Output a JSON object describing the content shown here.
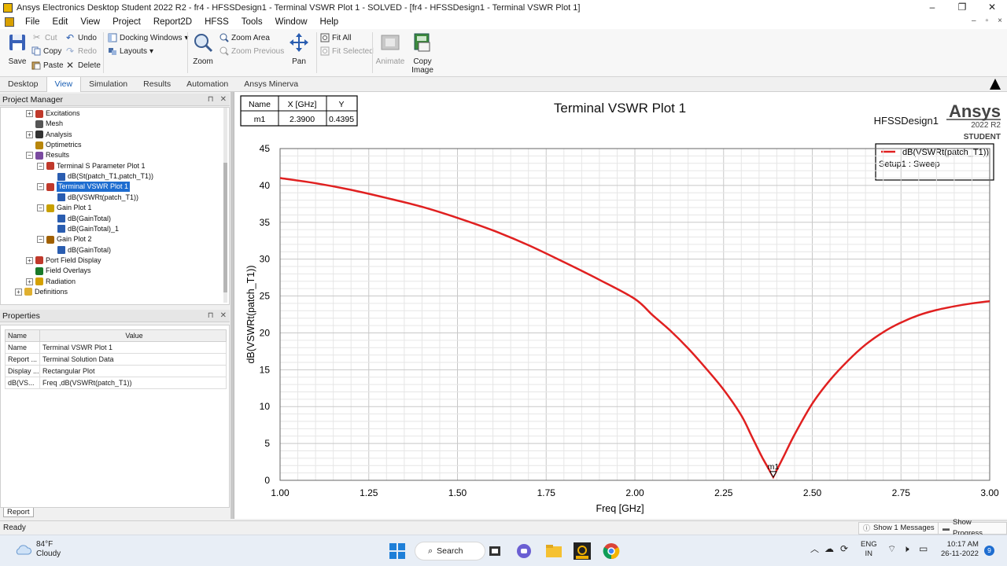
{
  "window": {
    "title": "Ansys Electronics Desktop Student 2022 R2 - fr4 - HFSSDesign1 - Terminal VSWR Plot 1 - SOLVED - [fr4 - HFSSDesign1 - Terminal VSWR Plot 1]",
    "buttons": {
      "minimize": "–",
      "restore": "❐",
      "close": "✕"
    }
  },
  "menu": [
    "File",
    "Edit",
    "View",
    "Project",
    "Report2D",
    "HFSS",
    "Tools",
    "Window",
    "Help"
  ],
  "mdi_buttons": {
    "minimize": "–",
    "restore": "▫",
    "close": "×"
  },
  "ribbon": {
    "save": "Save",
    "cut": "Cut",
    "copy": "Copy",
    "paste": "Paste",
    "undo": "Undo",
    "redo": "Redo",
    "delete": "Delete",
    "docking_windows": "Docking Windows",
    "layouts": "Layouts",
    "zoom": "Zoom",
    "zoom_area": "Zoom Area",
    "zoom_previous": "Zoom Previous",
    "pan": "Pan",
    "fit_all": "Fit All",
    "fit_selected": "Fit Selected",
    "animate": "Animate",
    "copy_image_1": "Copy",
    "copy_image_2": "Image"
  },
  "tabs": [
    "Desktop",
    "View",
    "Simulation",
    "Results",
    "Automation",
    "Ansys Minerva"
  ],
  "active_tab": "View",
  "project_manager": {
    "title": "Project Manager",
    "pin": "⊓",
    "close": "✕",
    "tree": [
      {
        "label": "Excitations",
        "indent": 2,
        "toggle": "+",
        "icon": "excitations-icon"
      },
      {
        "label": "Mesh",
        "indent": 2,
        "toggle": "",
        "icon": "mesh-icon"
      },
      {
        "label": "Analysis",
        "indent": 2,
        "toggle": "+",
        "icon": "analysis-icon"
      },
      {
        "label": "Optimetrics",
        "indent": 2,
        "toggle": "",
        "icon": "optimetrics-icon"
      },
      {
        "label": "Results",
        "indent": 2,
        "toggle": "−",
        "icon": "results-icon"
      },
      {
        "label": "Terminal S Parameter Plot 1",
        "indent": 3,
        "toggle": "−",
        "icon": "rect-plot-icon"
      },
      {
        "label": "dB(St(patch_T1,patch_T1))",
        "indent": 4,
        "toggle": "",
        "icon": "trace-icon"
      },
      {
        "label": "Terminal VSWR Plot 1",
        "indent": 3,
        "toggle": "−",
        "icon": "rect-plot-icon",
        "selected": true
      },
      {
        "label": "dB(VSWRt(patch_T1))",
        "indent": 4,
        "toggle": "",
        "icon": "trace-icon"
      },
      {
        "label": "Gain Plot 1",
        "indent": 3,
        "toggle": "−",
        "icon": "radiation-plot-icon"
      },
      {
        "label": "dB(GainTotal)",
        "indent": 4,
        "toggle": "",
        "icon": "trace-icon"
      },
      {
        "label": "dB(GainTotal)_1",
        "indent": 4,
        "toggle": "",
        "icon": "trace-icon"
      },
      {
        "label": "Gain Plot 2",
        "indent": 3,
        "toggle": "−",
        "icon": "3d-plot-icon"
      },
      {
        "label": "dB(GainTotal)",
        "indent": 4,
        "toggle": "",
        "icon": "trace-icon"
      },
      {
        "label": "Port Field Display",
        "indent": 2,
        "toggle": "+",
        "icon": "port-field-icon"
      },
      {
        "label": "Field Overlays",
        "indent": 2,
        "toggle": "",
        "icon": "field-overlays-icon"
      },
      {
        "label": "Radiation",
        "indent": 2,
        "toggle": "+",
        "icon": "radiation-icon"
      },
      {
        "label": "Definitions",
        "indent": 1,
        "toggle": "+",
        "icon": "folder-icon"
      }
    ]
  },
  "properties": {
    "title": "Properties",
    "pin": "⊓",
    "close": "✕",
    "headers": [
      "Name",
      "Value"
    ],
    "rows": [
      [
        "Name",
        "Terminal VSWR Plot 1"
      ],
      [
        "Report ...",
        "Terminal Solution Data"
      ],
      [
        "Display ...",
        "Rectangular Plot"
      ],
      [
        "dB(VS...",
        "Freq ,dB(VSWRt(patch_T1))"
      ]
    ],
    "tab": "Report"
  },
  "plot": {
    "title": "Terminal VSWR Plot 1",
    "design": "HFSSDesign1",
    "brand": "Ansys",
    "brand_version": "2022 R2",
    "brand_edition": "STUDENT",
    "marker_table": {
      "headers": [
        "Name",
        "X [GHz]",
        "Y"
      ],
      "row": [
        "m1",
        "2.3900",
        "0.4395"
      ]
    },
    "legend": {
      "trace": "dB(VSWRt(patch_T1))",
      "setup": "Setup1 : Sweep"
    },
    "marker_label": "m1"
  },
  "chart_data": {
    "type": "line",
    "title": "Terminal VSWR Plot 1",
    "xlabel": "Freq [GHz]",
    "ylabel": "dB(VSWRt(patch_T1))",
    "xlim": [
      1.0,
      3.0
    ],
    "ylim": [
      0,
      45
    ],
    "xticks": [
      "1.00",
      "1.25",
      "1.50",
      "1.75",
      "2.00",
      "2.25",
      "2.50",
      "2.75",
      "3.00"
    ],
    "yticks": [
      "0",
      "5",
      "10",
      "15",
      "20",
      "25",
      "30",
      "35",
      "40",
      "45"
    ],
    "grid": true,
    "legend_position": "top-right",
    "series": [
      {
        "name": "dB(VSWRt(patch_T1))",
        "color": "#e02020",
        "x": [
          1.0,
          1.1,
          1.2,
          1.3,
          1.4,
          1.5,
          1.6,
          1.7,
          1.8,
          1.9,
          2.0,
          2.05,
          2.1,
          2.15,
          2.2,
          2.25,
          2.3,
          2.33,
          2.36,
          2.39,
          2.42,
          2.45,
          2.5,
          2.55,
          2.6,
          2.65,
          2.7,
          2.75,
          2.8,
          2.85,
          2.9,
          2.95,
          3.0
        ],
        "y": [
          41.0,
          40.3,
          39.4,
          38.3,
          37.1,
          35.6,
          33.9,
          31.9,
          29.6,
          27.2,
          24.6,
          22.4,
          20.3,
          17.9,
          15.2,
          12.3,
          8.8,
          5.9,
          3.0,
          0.44,
          3.3,
          6.2,
          10.4,
          13.6,
          16.2,
          18.4,
          20.1,
          21.4,
          22.4,
          23.1,
          23.6,
          24.0,
          24.3
        ]
      }
    ],
    "markers": [
      {
        "name": "m1",
        "x": 2.39,
        "y": 0.4395
      }
    ]
  },
  "status": {
    "ready": "Ready",
    "messages": "Show 1 Messages",
    "progress": "Show Progress"
  },
  "taskbar": {
    "temperature": "84°F",
    "weather": "Cloudy",
    "search": "Search",
    "lang_1": "ENG",
    "lang_2": "IN",
    "time": "10:17 AM",
    "date": "26-11-2022",
    "notifications": "9"
  }
}
